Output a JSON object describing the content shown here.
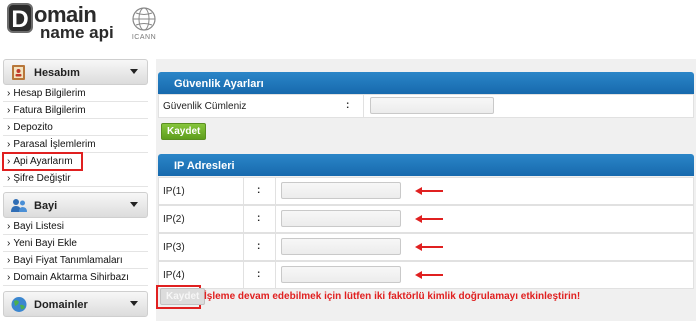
{
  "header": {
    "logo_word_top": "omain",
    "logo_letter": "D",
    "logo_word_bottom": "name api",
    "icann_label": "ICANN"
  },
  "sidebar": {
    "sections": [
      {
        "title": "Hesabım",
        "icon": "account-book-icon",
        "items": [
          "Hesap Bilgilerim",
          "Fatura Bilgilerim",
          "Depozito",
          "Parasal İşlemlerim",
          "Api Ayarlarım",
          "Şifre Değiştir"
        ]
      },
      {
        "title": "Bayi",
        "icon": "reseller-users-icon",
        "items": [
          "Bayi Listesi",
          "Yeni Bayi Ekle",
          "Bayi Fiyat Tanımlamaları",
          "Domain Aktarma Sihirbazı"
        ]
      },
      {
        "title": "Domainler",
        "icon": "globe-icon",
        "items": []
      }
    ],
    "highlighted_item": "Api Ayarlarım"
  },
  "security": {
    "title": "Güvenlik Ayarları",
    "phrase_label": "Güvenlik Cümleniz",
    "colon": ":",
    "phrase_value": "",
    "save_label": "Kaydet"
  },
  "ip": {
    "title": "IP Adresleri",
    "colon": ":",
    "rows": [
      {
        "label": "IP(1)",
        "value": ""
      },
      {
        "label": "IP(2)",
        "value": ""
      },
      {
        "label": "IP(3)",
        "value": ""
      },
      {
        "label": "IP(4)",
        "value": ""
      }
    ],
    "save_label": "Kaydet",
    "warning": "İşleme devam edebilmek için lütfen iki faktörlü kimlik doğrulamayı etkinleştirin!"
  },
  "colors": {
    "header_blue": "#1f77bb",
    "save_green": "#6fae28",
    "warning_red": "#e02020",
    "highlight_red": "#e02020"
  }
}
